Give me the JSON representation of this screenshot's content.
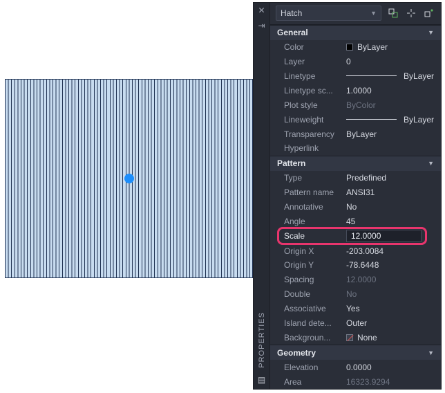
{
  "side_label": "PROPERTIES",
  "header": {
    "object_type": "Hatch"
  },
  "sections": {
    "general": {
      "title": "General",
      "color_label": "Color",
      "color_value": "ByLayer",
      "layer_label": "Layer",
      "layer_value": "0",
      "linetype_label": "Linetype",
      "linetype_value": "ByLayer",
      "ltscale_label": "Linetype sc...",
      "ltscale_value": "1.0000",
      "plotstyle_label": "Plot style",
      "plotstyle_value": "ByColor",
      "lineweight_label": "Lineweight",
      "lineweight_value": "ByLayer",
      "transparency_label": "Transparency",
      "transparency_value": "ByLayer",
      "hyperlink_label": "Hyperlink",
      "hyperlink_value": ""
    },
    "pattern": {
      "title": "Pattern",
      "type_label": "Type",
      "type_value": "Predefined",
      "name_label": "Pattern name",
      "name_value": "ANSI31",
      "annotative_label": "Annotative",
      "annotative_value": "No",
      "angle_label": "Angle",
      "angle_value": "45",
      "scale_label": "Scale",
      "scale_value": "12.0000",
      "originx_label": "Origin X",
      "originx_value": "-203.0084",
      "originy_label": "Origin Y",
      "originy_value": "-78.6448",
      "spacing_label": "Spacing",
      "spacing_value": "12.0000",
      "double_label": "Double",
      "double_value": "No",
      "assoc_label": "Associative",
      "assoc_value": "Yes",
      "island_label": "Island dete...",
      "island_value": "Outer",
      "bg_label": "Backgroun...",
      "bg_value": "None"
    },
    "geometry": {
      "title": "Geometry",
      "elev_label": "Elevation",
      "elev_value": "0.0000",
      "area_label": "Area",
      "area_value": "16323.9294"
    }
  }
}
